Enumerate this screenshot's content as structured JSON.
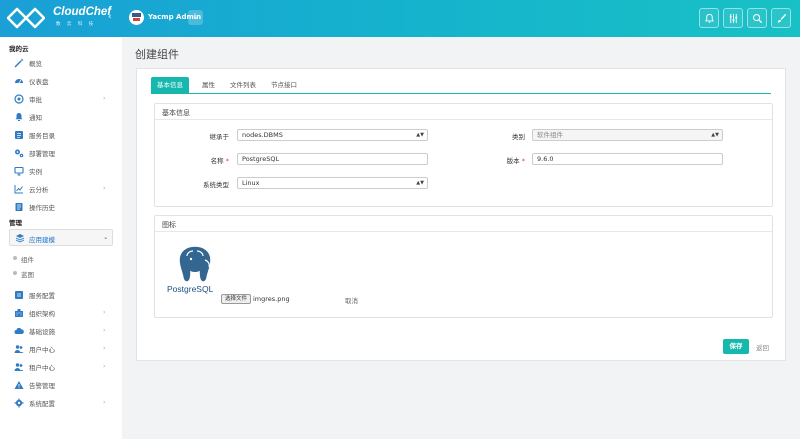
{
  "header": {
    "brand": "CloudChef",
    "brand_sub": "数 云 科 技",
    "user_name": "Yacmp Admin",
    "accent": "#16b7ac"
  },
  "sidebar": {
    "section_mycloud": "我的云",
    "section_manage": "管理",
    "items": [
      {
        "label": "概览",
        "icon": "wand-icon"
      },
      {
        "label": "仪表盘",
        "icon": "dashboard-icon"
      },
      {
        "label": "审批",
        "icon": "approval-icon",
        "chevron": "›"
      },
      {
        "label": "通知",
        "icon": "bell-icon"
      },
      {
        "label": "服务目录",
        "icon": "catalog-icon"
      },
      {
        "label": "部署管理",
        "icon": "cogs-icon"
      },
      {
        "label": "实例",
        "icon": "monitor-icon"
      },
      {
        "label": "云分析",
        "icon": "chart-icon",
        "chevron": "›"
      },
      {
        "label": "操作历史",
        "icon": "history-icon"
      }
    ],
    "app_build": {
      "label": "应用建模",
      "chevron": "⌄"
    },
    "sub_items": [
      {
        "label": "组件"
      },
      {
        "label": "蓝图"
      }
    ],
    "manage_items": [
      {
        "label": "服务配置",
        "icon": "service-config-icon"
      },
      {
        "label": "组织架构",
        "icon": "org-icon",
        "chevron": "›"
      },
      {
        "label": "基础设施",
        "icon": "cloud-icon",
        "chevron": "›"
      },
      {
        "label": "用户中心",
        "icon": "users-icon",
        "chevron": "›"
      },
      {
        "label": "租户中心",
        "icon": "tenant-icon",
        "chevron": "›"
      },
      {
        "label": "告警管理",
        "icon": "warning-icon"
      },
      {
        "label": "系统配置",
        "icon": "gear-icon",
        "chevron": "›"
      }
    ]
  },
  "main": {
    "title": "创建组件",
    "tabs": [
      {
        "label": "基本信息"
      },
      {
        "label": "属性"
      },
      {
        "label": "文件列表"
      },
      {
        "label": "节点接口"
      }
    ],
    "basic_info": {
      "title": "基本信息",
      "inherit_label": "继承于",
      "inherit_value": "nodes.DBMS",
      "name_label": "名称",
      "name_value": "PostgreSQL",
      "os_label": "系统类型",
      "os_value": "Linux",
      "category_label": "类别",
      "category_value": "软件组件",
      "version_label": "版本",
      "version_value": "9.6.0",
      "required_mark": "*"
    },
    "icon_box": {
      "title": "图标",
      "logo_text": "PostgreSQL",
      "file_button": "选择文件",
      "file_name": "imgres.png",
      "cancel": "取消"
    },
    "footer": {
      "save": "保存",
      "back": "返回"
    }
  }
}
